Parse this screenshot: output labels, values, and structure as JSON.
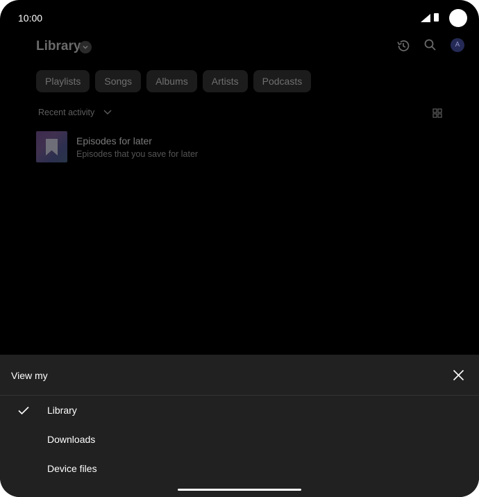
{
  "status_bar": {
    "time": "10:00"
  },
  "header": {
    "title": "Library",
    "avatar_letter": "A"
  },
  "chips": [
    "Playlists",
    "Songs",
    "Albums",
    "Artists",
    "Podcasts"
  ],
  "sort": {
    "label": "Recent activity"
  },
  "list": [
    {
      "title": "Episodes for later",
      "subtitle": "Episodes that you save for later"
    }
  ],
  "sheet": {
    "title": "View my",
    "items": [
      {
        "label": "Library",
        "selected": true
      },
      {
        "label": "Downloads",
        "selected": false
      },
      {
        "label": "Device files",
        "selected": false
      }
    ]
  },
  "colors": {
    "background": "#000000",
    "sheet": "#212121",
    "avatar": "#242a55"
  }
}
